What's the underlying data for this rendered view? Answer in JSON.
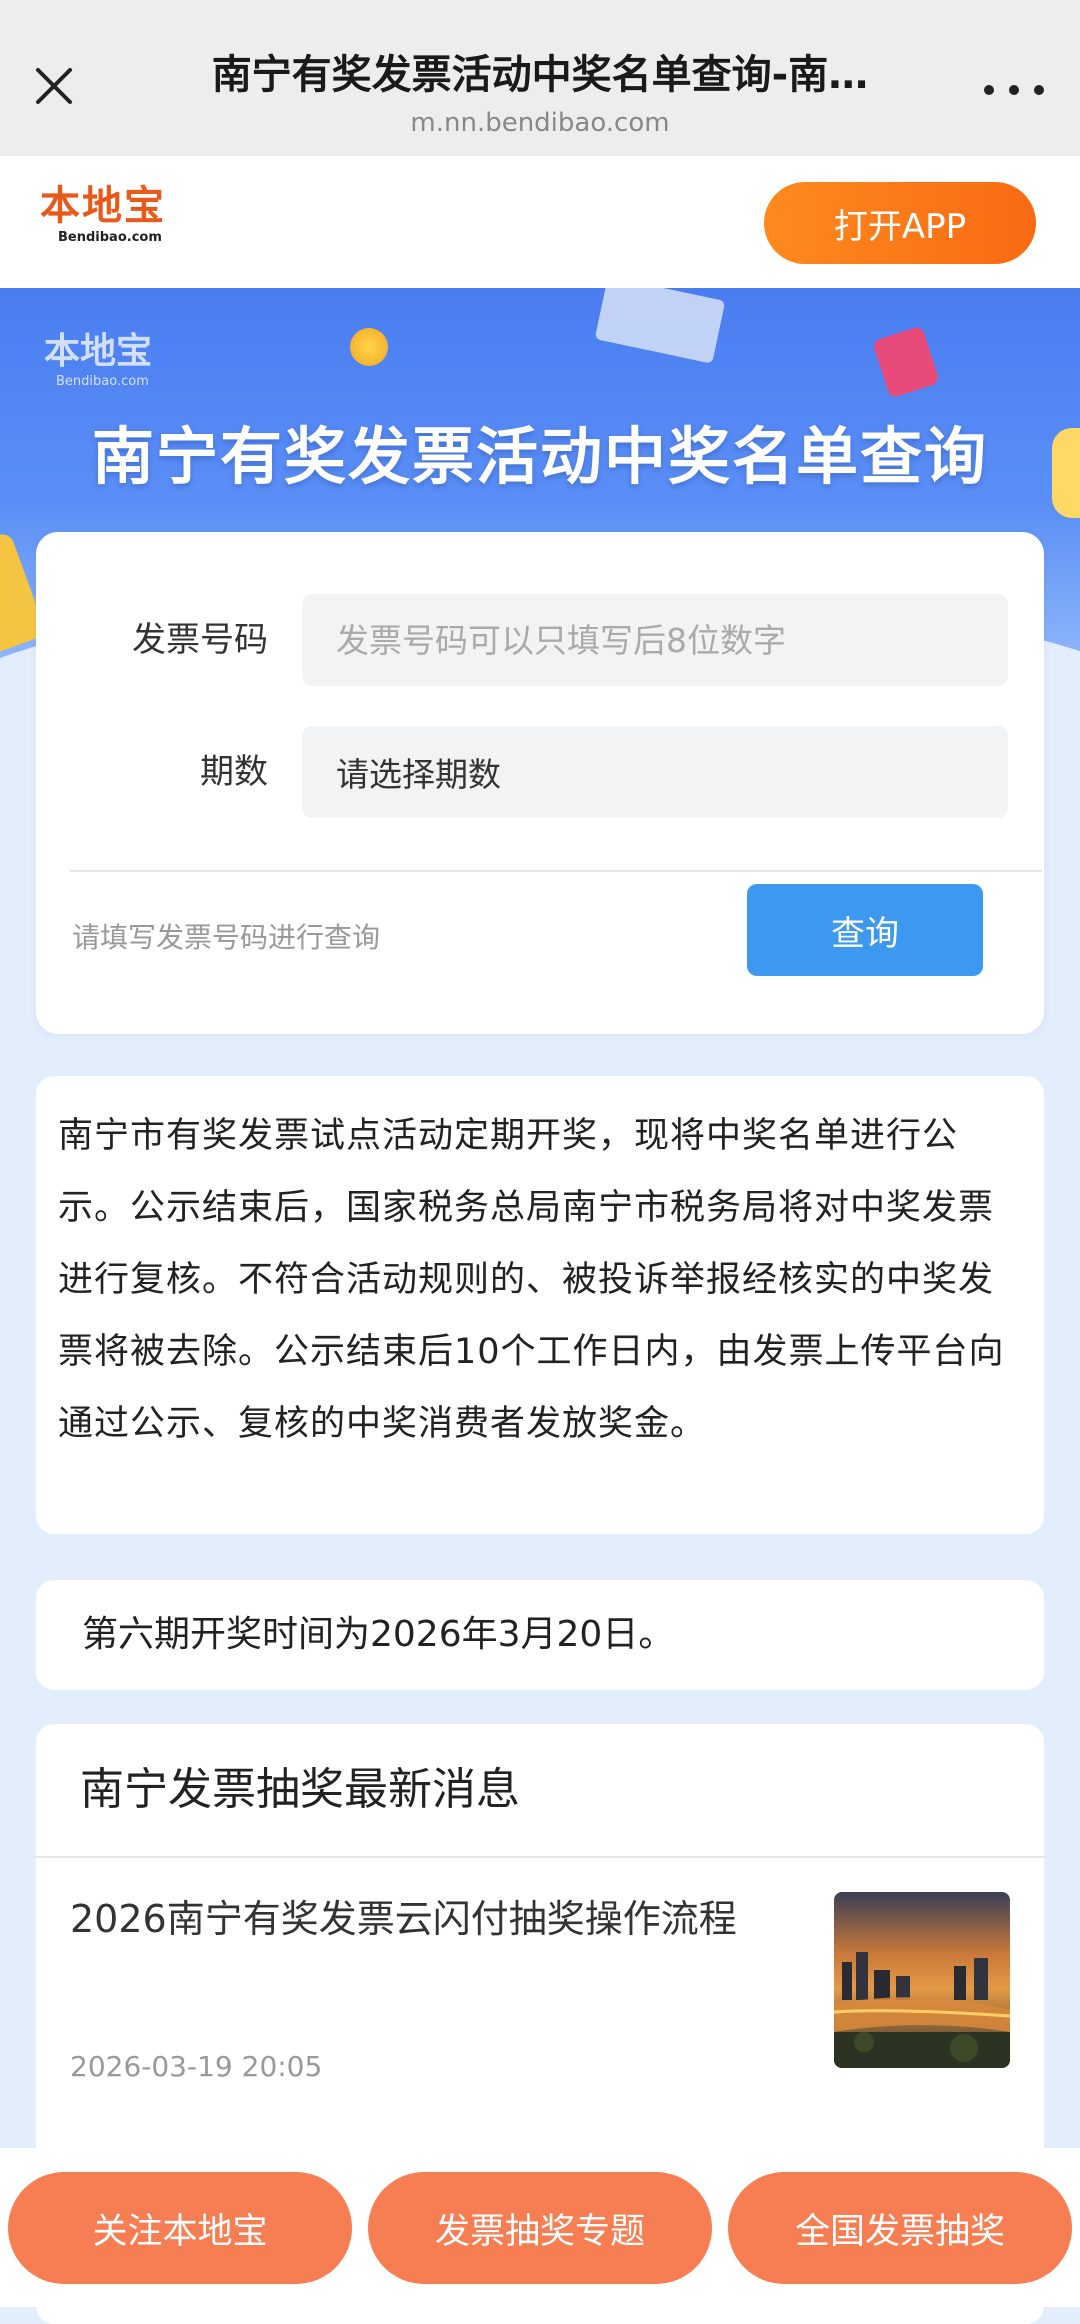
{
  "browser": {
    "title": "南宁有奖发票活动中奖名单查询-南…",
    "url": "m.nn.bendibao.com"
  },
  "header": {
    "logo_text": "本地宝",
    "logo_sub": "Bendibao.com",
    "open_app_label": "打开APP"
  },
  "banner": {
    "logo_text": "本地宝",
    "logo_sub": "Bendibao.com",
    "title": "南宁有奖发票活动中奖名单查询"
  },
  "query": {
    "invoice_label": "发票号码",
    "invoice_placeholder": "发票号码可以只填写后8位数字",
    "invoice_value": "",
    "period_label": "期数",
    "period_value": "请选择期数",
    "hint": "请填写发票号码进行查询",
    "submit_label": "查询"
  },
  "notice": {
    "text": "南宁市有奖发票试点活动定期开奖，现将中奖名单进行公示。公示结束后，国家税务总局南宁市税务局将对中奖发票进行复核。不符合活动规则的、被投诉举报经核实的中奖发票将被去除。公示结束后10个工作日内，由发票上传平台向通过公示、复核的中奖消费者发放奖金。"
  },
  "draw_date": {
    "text": "第六期开奖时间为2026年3月20日。"
  },
  "news": {
    "heading": "南宁发票抽奖最新消息",
    "items": [
      {
        "title": "2026南宁有奖发票云闪付抽奖操作流程",
        "date": "2026-03-19 20:05",
        "thumb_icon": "city-night-thumbnail"
      }
    ]
  },
  "bottom_nav": {
    "follow_label": "关注本地宝",
    "topic_label": "发票抽奖专题",
    "national_label": "全国发票抽奖"
  },
  "colors": {
    "brand_orange": "#f86a12",
    "banner_blue": "#4a7df0",
    "button_blue": "#3d98f0",
    "bottom_button": "#f77e52"
  }
}
